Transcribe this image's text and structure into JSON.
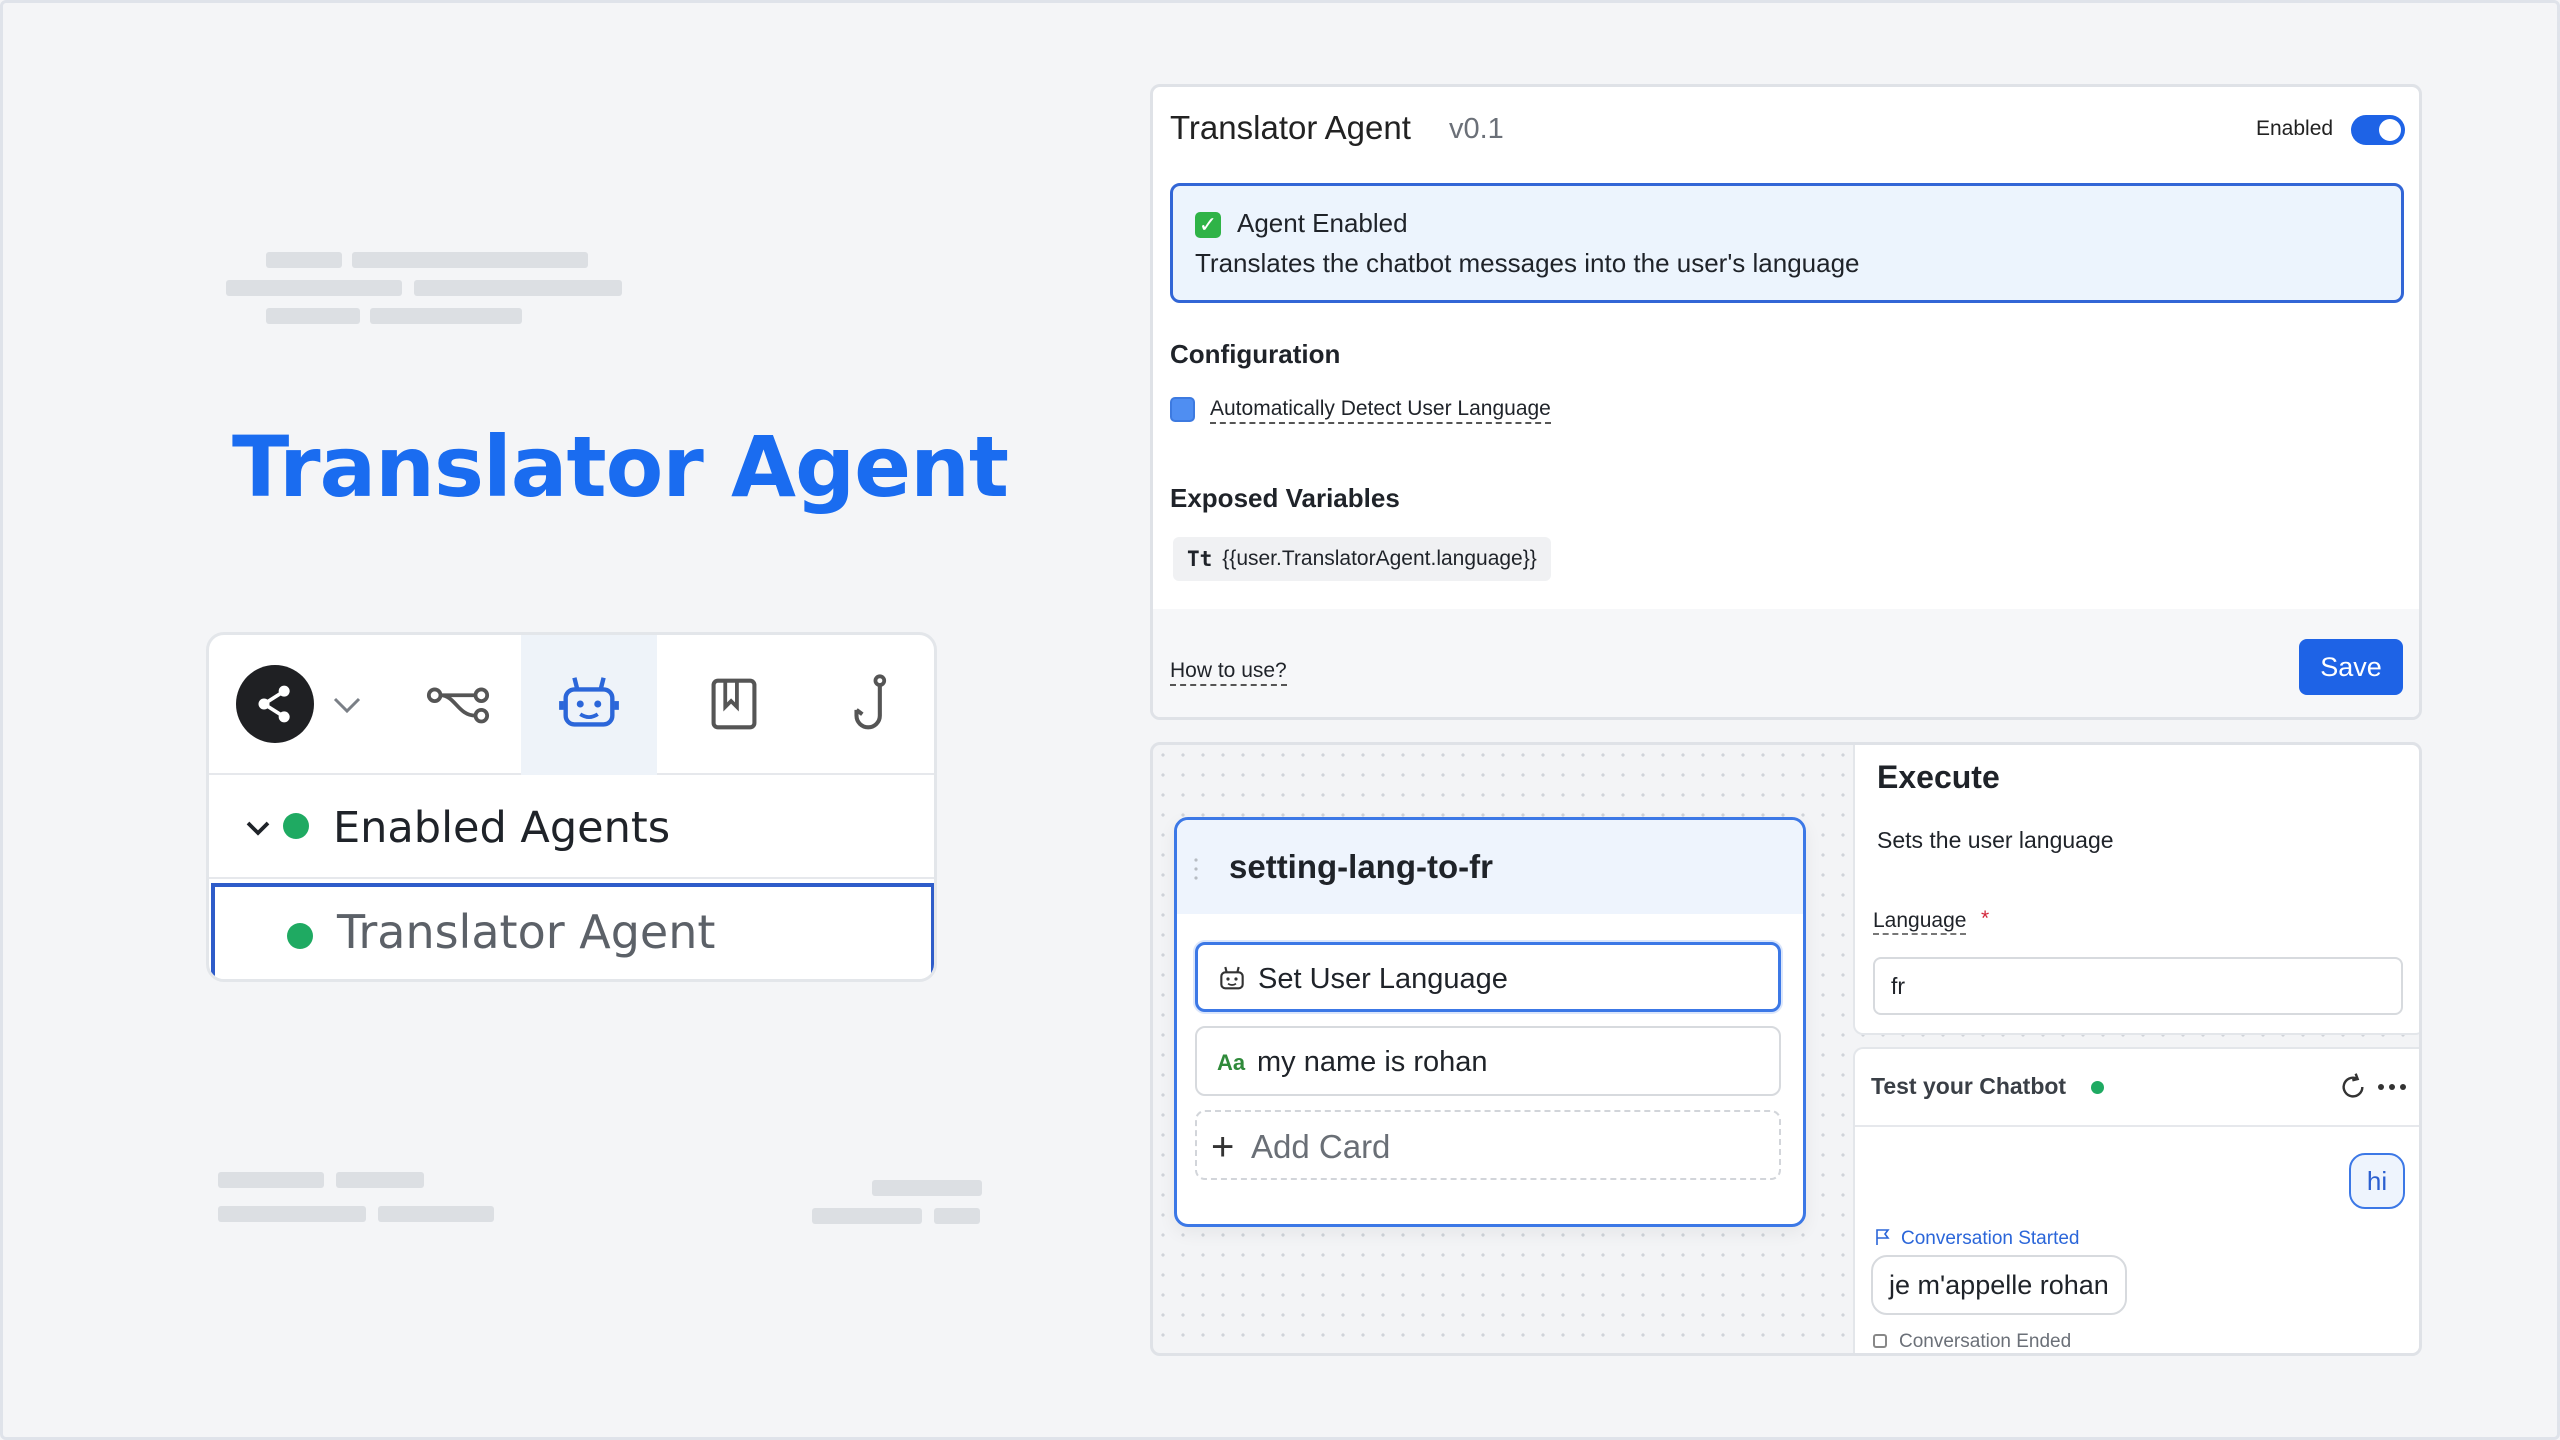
{
  "hero": {
    "title": "Translator Agent"
  },
  "nav": {
    "toolbar_icons": [
      "share-icon",
      "chevron-down-icon",
      "workflow-icon",
      "robot-icon",
      "book-icon",
      "hook-icon"
    ],
    "active_icon": "robot-icon",
    "section_label": "Enabled Agents",
    "agent_item": "Translator Agent"
  },
  "agent_panel": {
    "title": "Translator Agent",
    "version": "v0.1",
    "enabled_label": "Enabled",
    "enabled": true,
    "status": {
      "title": "Agent Enabled",
      "description": "Translates the chatbot messages into the user's language"
    },
    "configuration": {
      "heading": "Configuration",
      "auto_detect_label": "Automatically Detect User Language"
    },
    "variables": {
      "heading": "Exposed Variables",
      "type_badge": "Tt",
      "variable": "{{user.TranslatorAgent.language}}"
    },
    "footer": {
      "help_link": "How to use?",
      "save_label": "Save"
    }
  },
  "workflow": {
    "node": {
      "title": "setting-lang-to-fr",
      "cards": [
        {
          "icon": "robot-icon",
          "label": "Set User Language"
        },
        {
          "icon": "text-icon",
          "icon_text": "Aa",
          "label": "my name is rohan"
        }
      ],
      "add_card_label": "Add Card"
    },
    "execute": {
      "title": "Execute",
      "description": "Sets the user language",
      "field_label": "Language",
      "required_mark": "*",
      "field_value": "fr"
    },
    "chat": {
      "title": "Test your Chatbot",
      "user_message": "hi",
      "started_label": "Conversation Started",
      "bot_message": "je m'appelle rohan",
      "ended_label": "Conversation Ended"
    }
  },
  "colors": {
    "brand_blue": "#1a6cf0",
    "accent": "#1e63e6",
    "online_green": "#1faa62"
  }
}
